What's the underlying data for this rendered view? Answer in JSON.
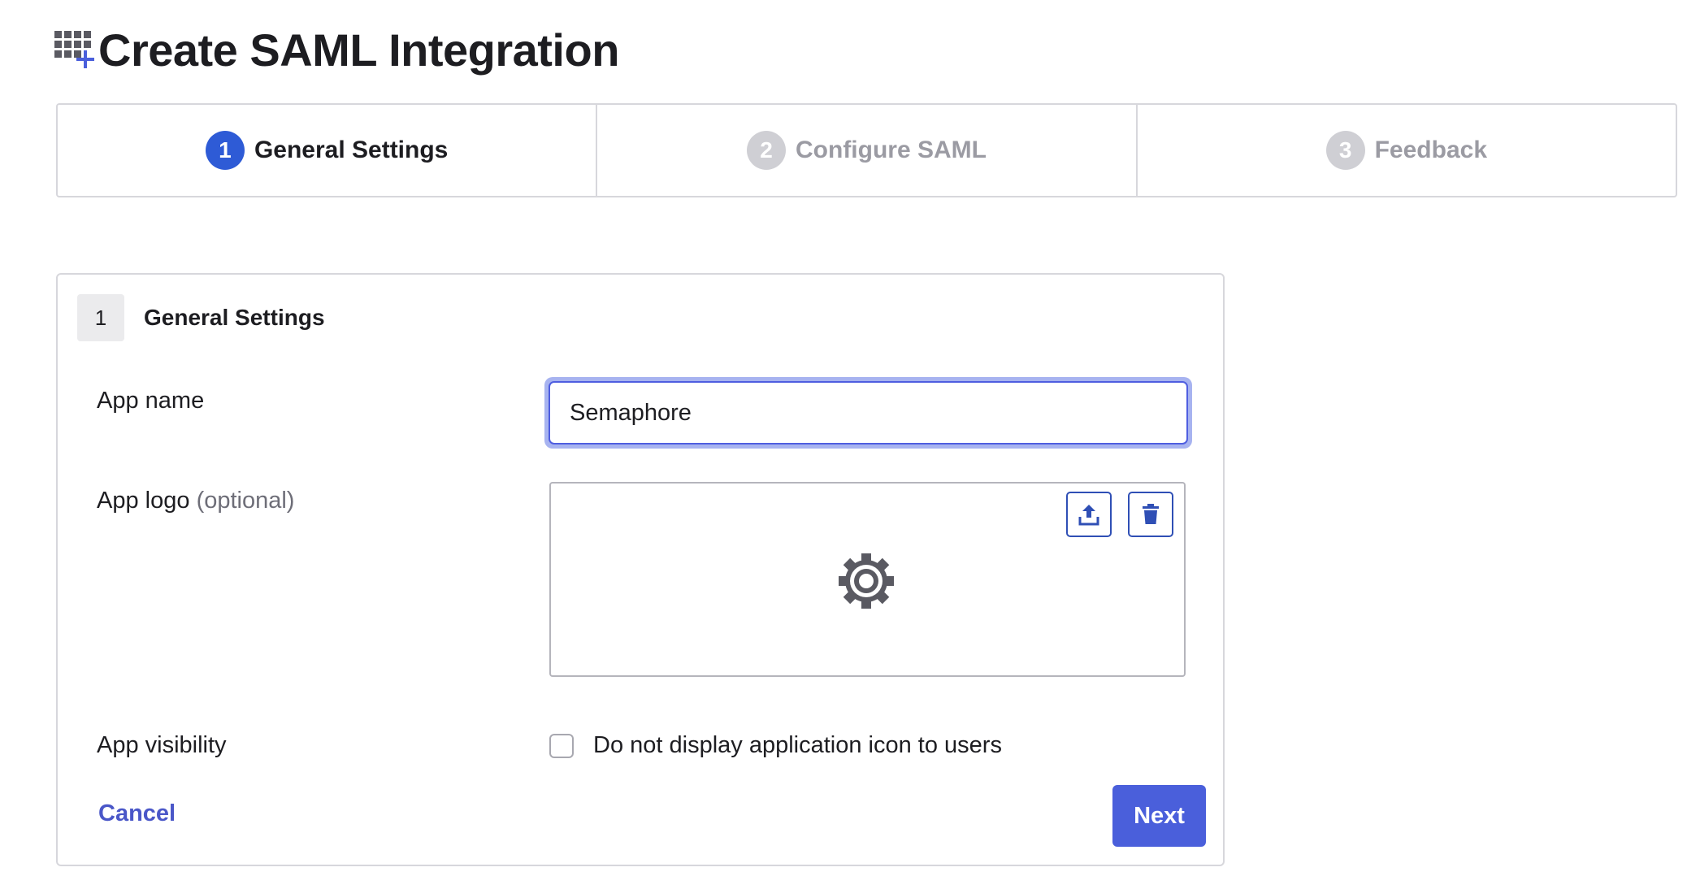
{
  "header": {
    "title": "Create SAML Integration",
    "icon": "app-grid-add-icon"
  },
  "stepper": {
    "steps": [
      {
        "number": "1",
        "label": "General Settings",
        "state": "active"
      },
      {
        "number": "2",
        "label": "Configure SAML",
        "state": "inactive"
      },
      {
        "number": "3",
        "label": "Feedback",
        "state": "inactive"
      }
    ]
  },
  "form": {
    "section_number": "1",
    "section_title": "General Settings",
    "app_name": {
      "label": "App name",
      "value": "Semaphore"
    },
    "app_logo": {
      "label": "App logo",
      "optional": "(optional)",
      "upload_icon": "upload-icon",
      "delete_icon": "trash-icon",
      "placeholder_icon": "gear-icon"
    },
    "app_visibility": {
      "label": "App visibility",
      "checkbox_label": "Do not display application icon to users",
      "checked": false
    },
    "cancel_label": "Cancel",
    "next_label": "Next"
  },
  "colors": {
    "accent": "#4a5fdb",
    "active_step": "#2e5bd6",
    "inactive_step": "#cfcfd4",
    "link": "#4a57c8"
  }
}
